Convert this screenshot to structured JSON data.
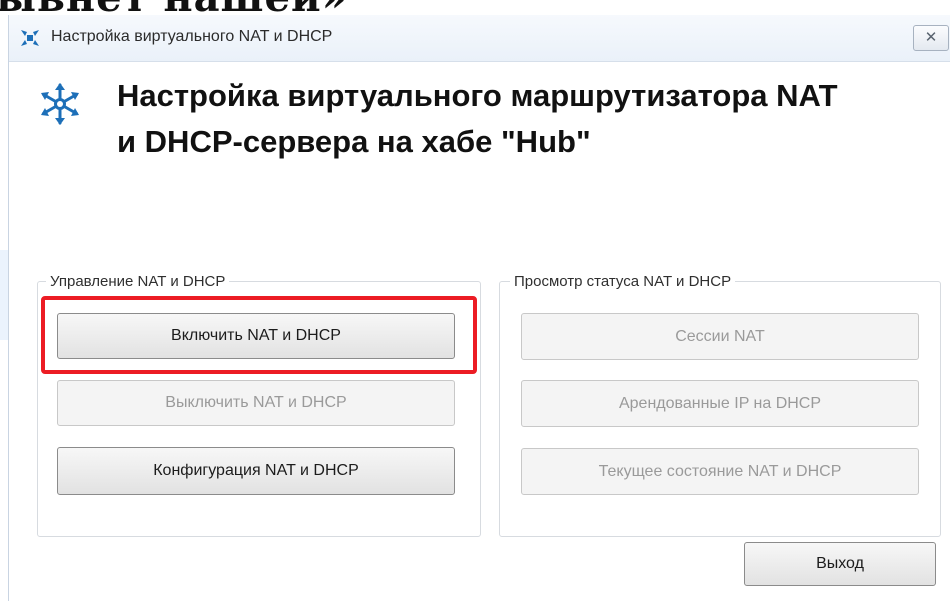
{
  "page_fragment": "ывнет нашей»",
  "window": {
    "title": "Настройка виртуального NAT и DHCP",
    "close_glyph": "✕"
  },
  "header": {
    "line1": "Настройка виртуального маршрутизатора NAT",
    "line2": "и DHCP-сервера на хабе \"Hub\""
  },
  "manage_group": {
    "legend": "Управление NAT и DHCP",
    "enable_label": "Включить NAT и DHCP",
    "disable_label": "Выключить NAT и DHCP",
    "config_label": "Конфигурация NAT и DHCP"
  },
  "status_group": {
    "legend": "Просмотр статуса NAT и DHCP",
    "sessions_label": "Сессии NAT",
    "leases_label": "Арендованные IP на DHCP",
    "state_label": "Текущее состояние NAT и DHCP"
  },
  "footer": {
    "exit_label": "Выход"
  },
  "colors": {
    "highlight": "#ec1c24",
    "icon_blue": "#1d6fb8",
    "title_text": "#2b2b2b"
  },
  "icons": {
    "app": "network-star-icon",
    "header": "network-star-icon"
  }
}
